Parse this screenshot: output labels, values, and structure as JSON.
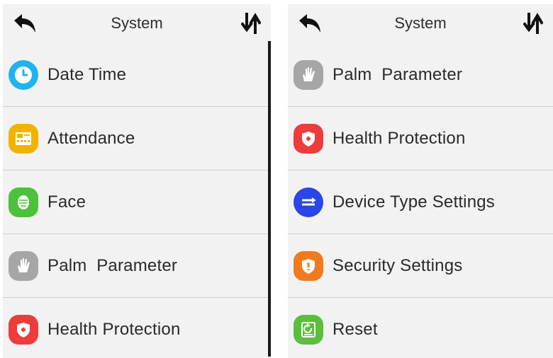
{
  "screens": [
    {
      "header": {
        "title": "System",
        "back_icon": "back-arrow-icon",
        "sort_icon": "sort-arrows-icon"
      },
      "items": [
        {
          "label": "Date Time",
          "icon": "clock-icon",
          "color": "#1eb4ee"
        },
        {
          "label": "Attendance",
          "icon": "attendance-icon",
          "color": "#f0b400"
        },
        {
          "label": "Face",
          "icon": "face-icon",
          "color": "#4cc13a"
        },
        {
          "label": "Palm  Parameter",
          "icon": "palm-icon",
          "color": "#a6a6a6"
        },
        {
          "label": "Health Protection",
          "icon": "shield-icon",
          "color": "#ee3b3b"
        }
      ]
    },
    {
      "header": {
        "title": "System",
        "back_icon": "back-arrow-icon",
        "sort_icon": "sort-arrows-icon"
      },
      "items": [
        {
          "label": "Palm  Parameter",
          "icon": "palm-icon",
          "color": "#a6a6a6"
        },
        {
          "label": "Health Protection",
          "icon": "shield-icon",
          "color": "#ee3b3b"
        },
        {
          "label": "Device Type Settings",
          "icon": "device-type-icon",
          "color": "#2a45e8"
        },
        {
          "label": "Security Settings",
          "icon": "security-shield-icon",
          "color": "#f07a1e"
        },
        {
          "label": "Reset",
          "icon": "reset-icon",
          "color": "#5cbe3c"
        }
      ]
    }
  ]
}
